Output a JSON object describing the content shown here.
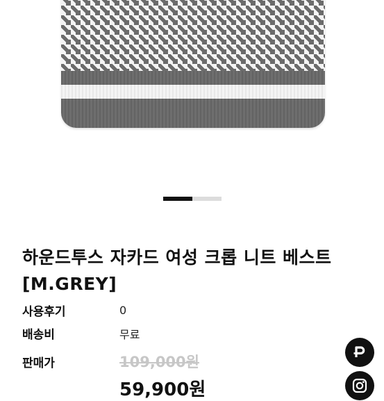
{
  "product": {
    "title": "하운드투스 자카드 여성 크롭 니트 베스트 [M.GREY]",
    "image": {
      "icon": "houndstooth-knit-vest-image",
      "colors": {
        "dark": "#6b6b6b",
        "light": "#f4f4f4",
        "rib": "#6e6e6e"
      }
    },
    "carousel": {
      "current": 1,
      "total": 2
    }
  },
  "details": {
    "reviews_label": "사용후기",
    "reviews_value": "0",
    "shipping_label": "배송비",
    "shipping_value": "무료",
    "price_label": "판매가",
    "original_price": "109,000원",
    "sale_price": "59,900원"
  },
  "floating": {
    "p_button": {
      "glyph": "P",
      "icon": "p-brand-icon"
    },
    "instagram_button": {
      "icon": "instagram-icon"
    }
  }
}
